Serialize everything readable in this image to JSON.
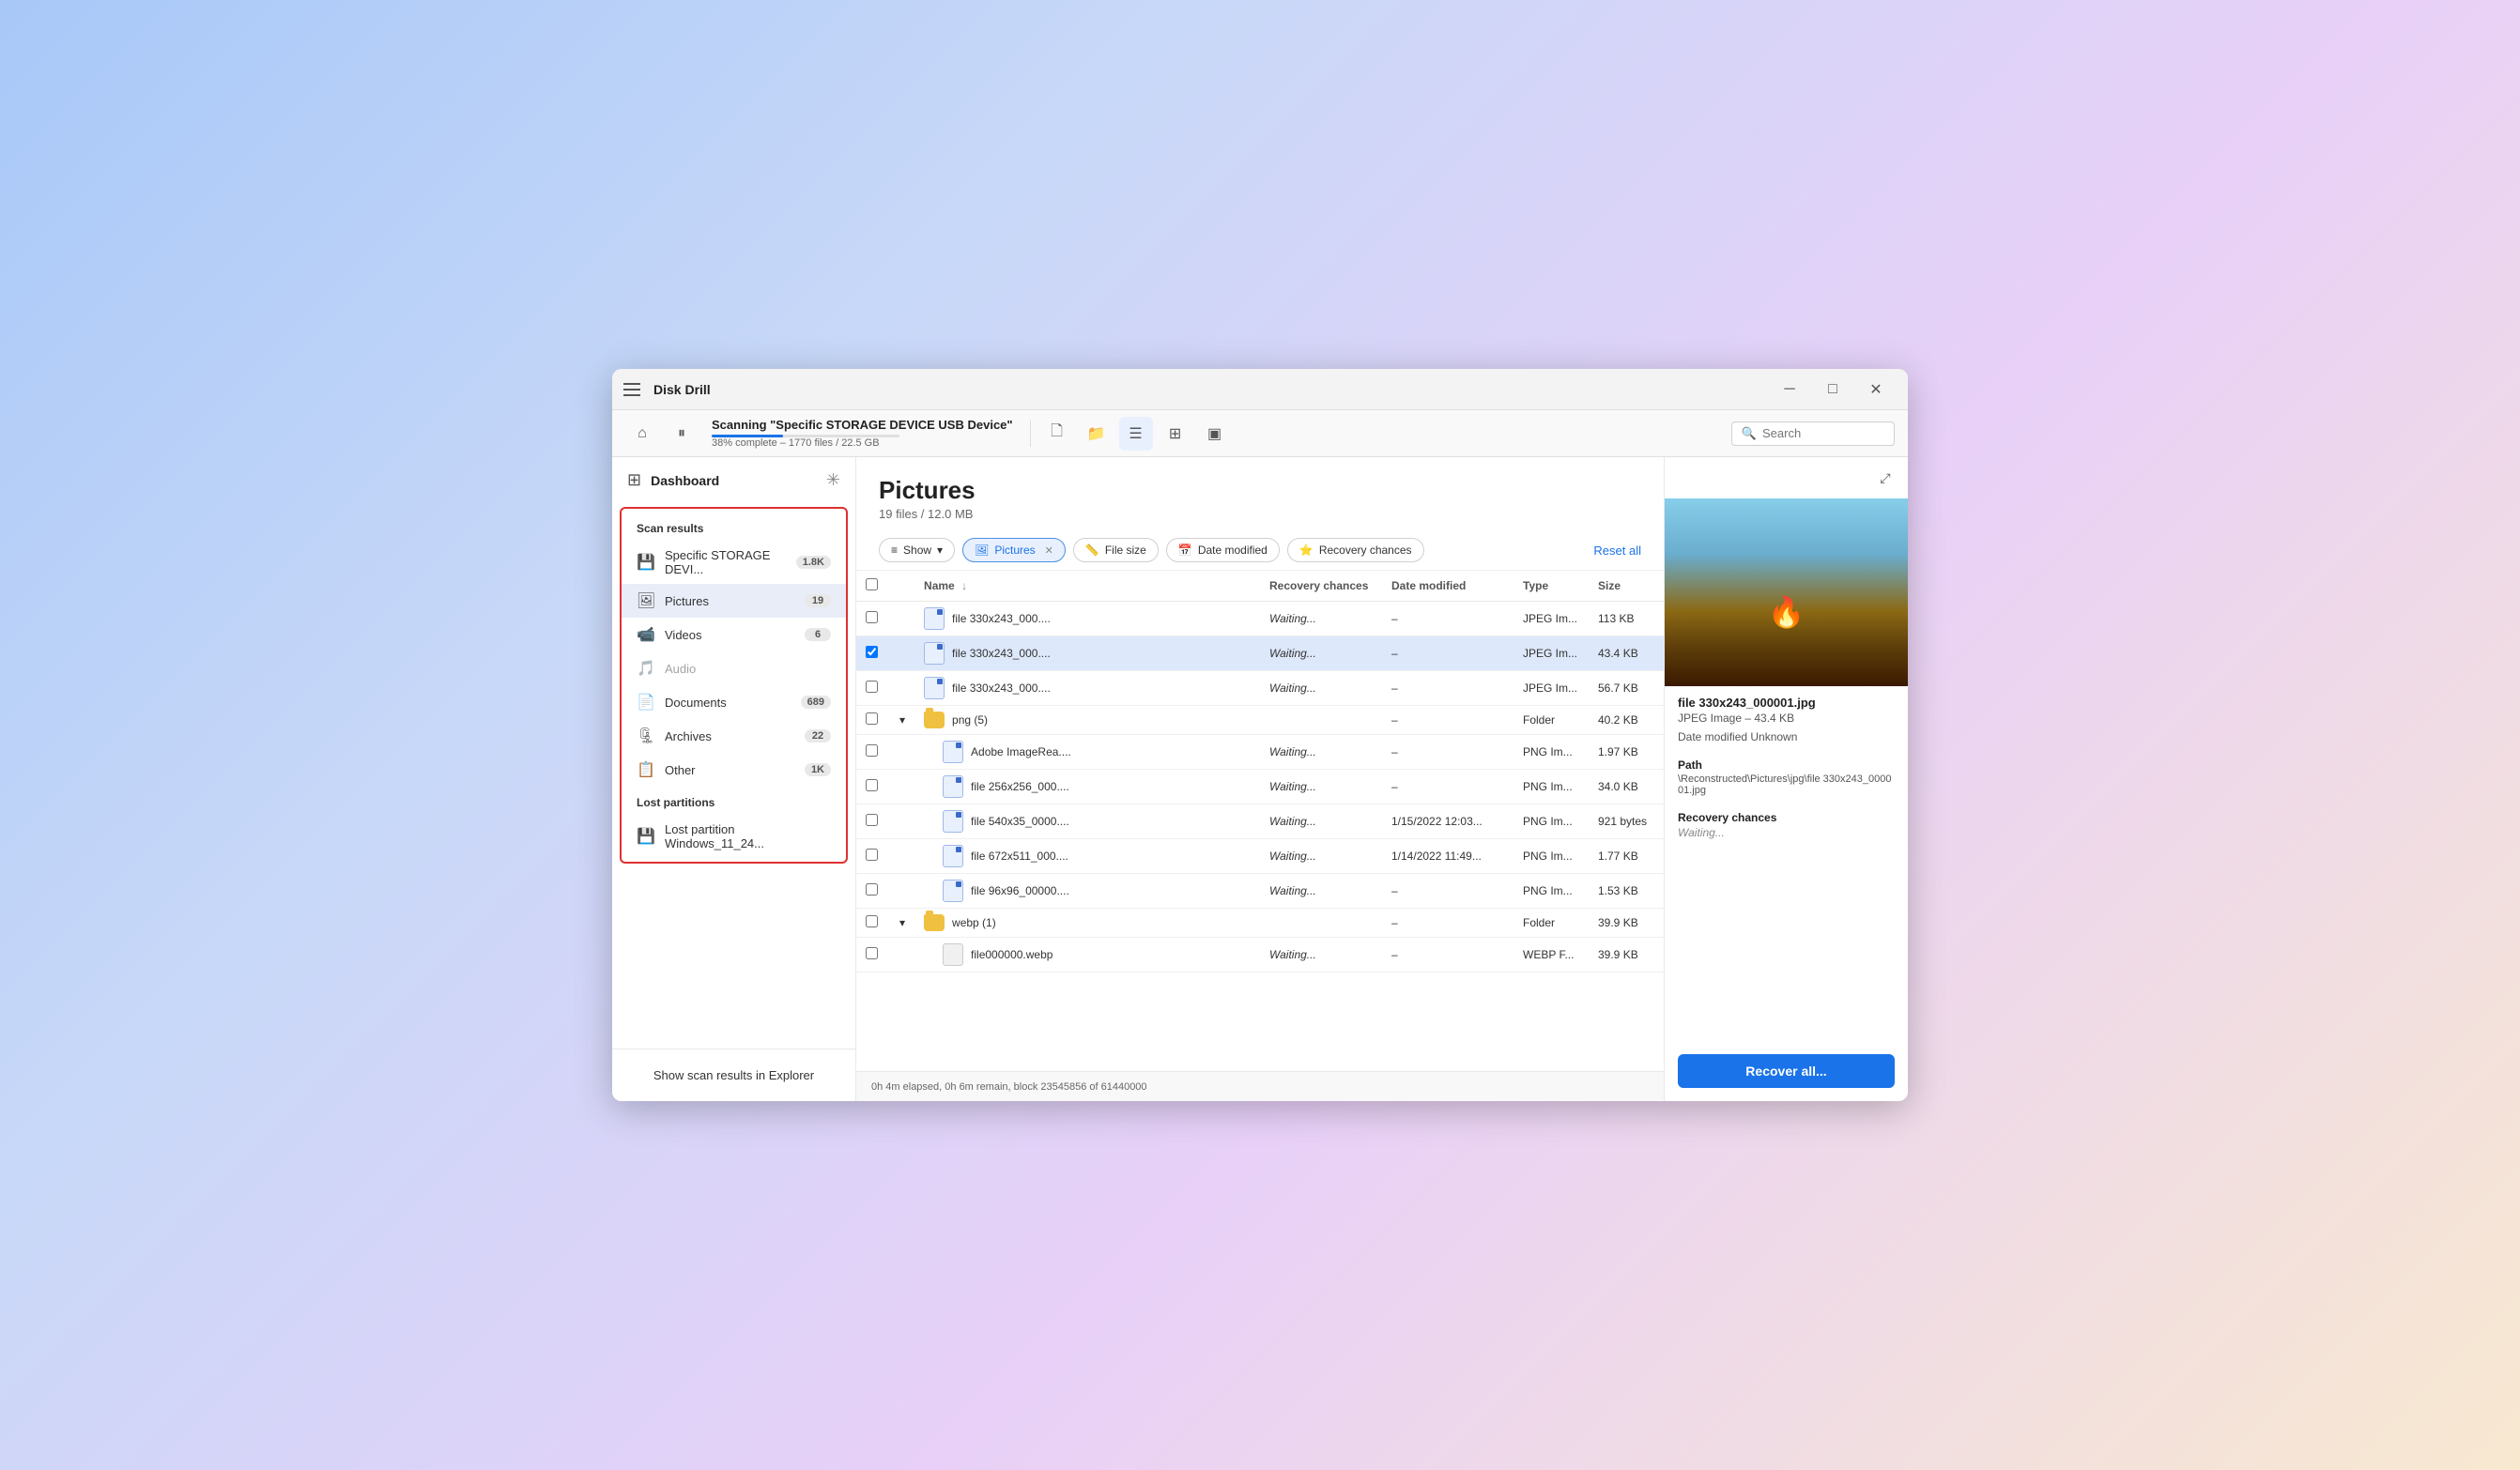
{
  "app": {
    "title": "Disk Drill",
    "menu_icon": "menu-icon"
  },
  "window_controls": {
    "minimize": "─",
    "maximize": "□",
    "close": "✕"
  },
  "toolbar": {
    "home_label": "⌂",
    "pause_label": "⏸",
    "scanning_title": "Scanning \"Specific STORAGE DEVICE USB Device\"",
    "scanning_sub": "38% complete – 1770 files / 22.5 GB",
    "progress_pct": 38,
    "btn_doc": "🗋",
    "btn_folder": "📁",
    "btn_list": "☰",
    "btn_grid": "⊞",
    "btn_panel": "▣",
    "search_placeholder": "Search"
  },
  "sidebar": {
    "dashboard_label": "Dashboard",
    "scan_results_label": "Scan results",
    "device_label": "Specific STORAGE DEVI...",
    "device_badge": "1.8K",
    "pictures_label": "Pictures",
    "pictures_badge": "19",
    "videos_label": "Videos",
    "videos_badge": "6",
    "audio_label": "Audio",
    "audio_badge": "",
    "documents_label": "Documents",
    "documents_badge": "689",
    "archives_label": "Archives",
    "archives_badge": "22",
    "other_label": "Other",
    "other_badge": "1K",
    "lost_partitions_label": "Lost partitions",
    "lost_partition_label": "Lost partition Windows_11_24...",
    "show_scan_btn": "Show scan results in Explorer"
  },
  "content": {
    "title": "Pictures",
    "subtitle": "19 files / 12.0 MB"
  },
  "filter_bar": {
    "show_btn": "Show",
    "pictures_filter": "Pictures",
    "file_size_filter": "File size",
    "date_modified_filter": "Date modified",
    "recovery_chances_filter": "Recovery chances",
    "reset_all": "Reset all"
  },
  "table": {
    "columns": [
      "Name",
      "Recovery chances",
      "Date modified",
      "Type",
      "Size"
    ],
    "rows": [
      {
        "id": 1,
        "name": "file 330x243_000....",
        "recovery": "Waiting...",
        "date": "–",
        "type": "JPEG Im...",
        "size": "113 KB",
        "indent": 0,
        "selected": false,
        "kind": "file"
      },
      {
        "id": 2,
        "name": "file 330x243_000....",
        "recovery": "Waiting...",
        "date": "–",
        "type": "JPEG Im...",
        "size": "43.4 KB",
        "indent": 0,
        "selected": true,
        "kind": "file"
      },
      {
        "id": 3,
        "name": "file 330x243_000....",
        "recovery": "Waiting...",
        "date": "–",
        "type": "JPEG Im...",
        "size": "56.7 KB",
        "indent": 0,
        "selected": false,
        "kind": "file"
      },
      {
        "id": 4,
        "name": "png (5)",
        "recovery": "",
        "date": "–",
        "type": "Folder",
        "size": "40.2 KB",
        "indent": 0,
        "selected": false,
        "kind": "folder",
        "expanded": true
      },
      {
        "id": 5,
        "name": "Adobe ImageRea....",
        "recovery": "Waiting...",
        "date": "–",
        "type": "PNG Im...",
        "size": "1.97 KB",
        "indent": 1,
        "selected": false,
        "kind": "file"
      },
      {
        "id": 6,
        "name": "file 256x256_000....",
        "recovery": "Waiting...",
        "date": "–",
        "type": "PNG Im...",
        "size": "34.0 KB",
        "indent": 1,
        "selected": false,
        "kind": "file"
      },
      {
        "id": 7,
        "name": "file 540x35_0000....",
        "recovery": "Waiting...",
        "date": "1/15/2022 12:03...",
        "type": "PNG Im...",
        "size": "921 bytes",
        "indent": 1,
        "selected": false,
        "kind": "file"
      },
      {
        "id": 8,
        "name": "file 672x511_000....",
        "recovery": "Waiting...",
        "date": "1/14/2022 11:49...",
        "type": "PNG Im...",
        "size": "1.77 KB",
        "indent": 1,
        "selected": false,
        "kind": "file"
      },
      {
        "id": 9,
        "name": "file 96x96_00000....",
        "recovery": "Waiting...",
        "date": "–",
        "type": "PNG Im...",
        "size": "1.53 KB",
        "indent": 1,
        "selected": false,
        "kind": "file"
      },
      {
        "id": 10,
        "name": "webp (1)",
        "recovery": "",
        "date": "–",
        "type": "Folder",
        "size": "39.9 KB",
        "indent": 0,
        "selected": false,
        "kind": "folder",
        "expanded": true
      },
      {
        "id": 11,
        "name": "file000000.webp",
        "recovery": "Waiting...",
        "date": "–",
        "type": "WEBP F...",
        "size": "39.9 KB",
        "indent": 1,
        "selected": false,
        "kind": "file-plain"
      }
    ]
  },
  "preview": {
    "expand_icon": "⤢",
    "file_name": "file 330x243_000001.jpg",
    "file_type": "JPEG Image – 43.4 KB",
    "date_label": "Date modified Unknown",
    "path_label": "Path",
    "path_value": "\\Reconstructed\\Pictures\\jpg\\file 330x243_000001.jpg",
    "recovery_label": "Recovery chances",
    "recovery_value": "Waiting..."
  },
  "recover_all_btn": "Recover all...",
  "status_bar": {
    "text": "0h 4m elapsed, 0h 6m remain, block 23545856 of 61440000"
  }
}
